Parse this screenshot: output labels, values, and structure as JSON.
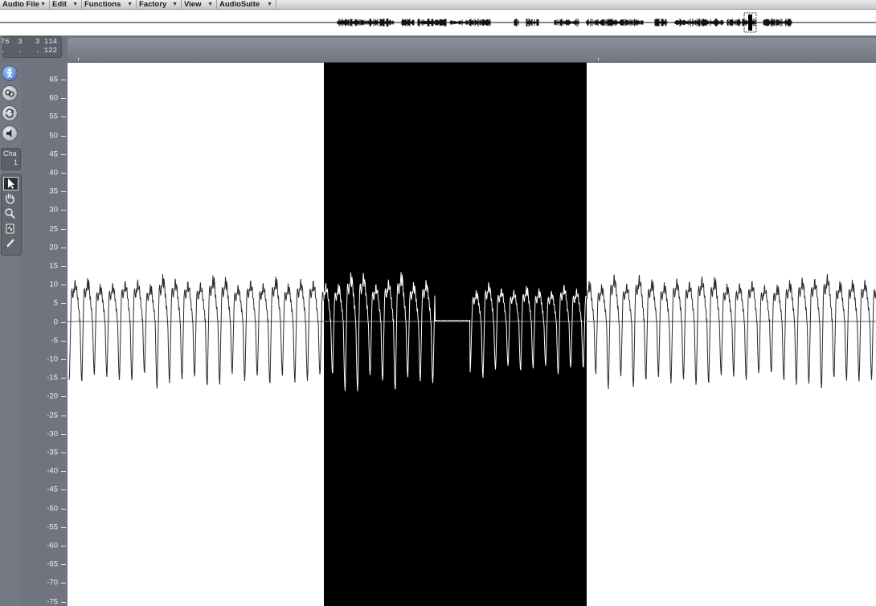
{
  "menu": [
    {
      "label": "Audio File",
      "has_dropdown": true
    },
    {
      "label": "Edit",
      "has_dropdown": true
    },
    {
      "label": "Functions",
      "has_dropdown": true
    },
    {
      "label": "Factory",
      "has_dropdown": true
    },
    {
      "label": "View",
      "has_dropdown": true
    },
    {
      "label": "AudioSuite",
      "has_dropdown": true
    }
  ],
  "position_display": {
    "line1": "76  3   3 114",
    "line2": ".   .   . 122"
  },
  "channel": {
    "label": "Cha",
    "value": "1"
  },
  "tool_buttons": [
    {
      "icon": "catch-playhead-icon",
      "active": true
    },
    {
      "icon": "link-icon",
      "active": false
    },
    {
      "icon": "cycle-icon",
      "active": false
    },
    {
      "icon": "speaker-icon",
      "active": false
    }
  ],
  "tools": [
    {
      "icon": "pointer-tool-icon",
      "selected": true
    },
    {
      "icon": "hand-tool-icon",
      "selected": false
    },
    {
      "icon": "zoom-tool-icon",
      "selected": false
    },
    {
      "icon": "scrub-tool-icon",
      "selected": false
    },
    {
      "icon": "pencil-tool-icon",
      "selected": false
    }
  ],
  "amplitude_axis": {
    "labels": [
      "65",
      "60",
      "55",
      "50",
      "45",
      "40",
      "35",
      "30",
      "25",
      "20",
      "15",
      "10",
      "5",
      "0",
      "-5",
      "-10",
      "-15",
      "-20",
      "-25",
      "-30",
      "-35",
      "-40",
      "-45",
      "-50",
      "-55",
      "-60",
      "-65",
      "-70",
      "-75"
    ]
  },
  "selection": {
    "start_fraction": 0.317,
    "end_fraction": 0.642
  },
  "colors": {
    "background": "#6f747e",
    "wave_bg": "#ffffff",
    "waveform": "#2a2a2a",
    "selection_bg": "#000000",
    "selection_wave": "#ffffff"
  }
}
